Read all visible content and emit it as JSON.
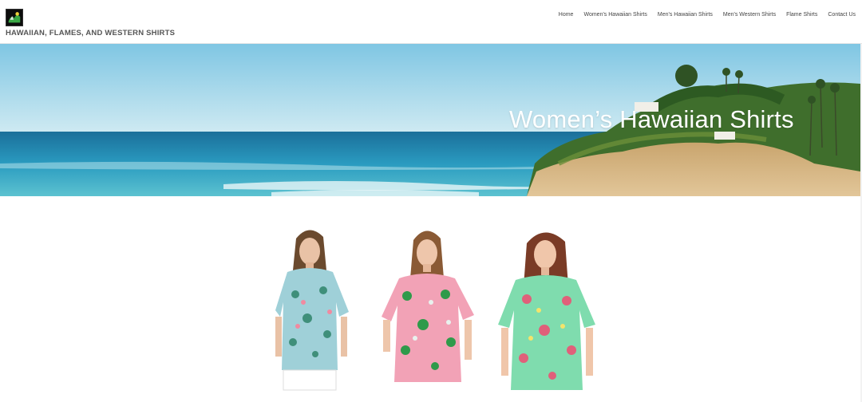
{
  "header": {
    "site_title": "HAWAIIAN, FLAMES, AND WESTERN SHIRTS",
    "logo_icon": "site-logo-icon"
  },
  "nav": {
    "items": [
      {
        "label": "Home"
      },
      {
        "label": "Women's Hawaiian Shirts"
      },
      {
        "label": "Men's Hawaiian Shirts"
      },
      {
        "label": "Men's Western Shirts"
      },
      {
        "label": "Flame Shirts"
      },
      {
        "label": "Contact Us"
      }
    ]
  },
  "hero": {
    "title": "Women’s Hawaiian Shirts"
  },
  "products": [
    {
      "shirt_color": "#9fd0d8",
      "pattern_color": "#3f8f7a"
    },
    {
      "shirt_color": "#f2a2b6",
      "pattern_color": "#2f9a4a"
    },
    {
      "shirt_color": "#7fdcae",
      "pattern_color": "#e0607a"
    }
  ],
  "colors": {
    "sky": "#a8d8ea",
    "ocean": "#1f8fb8",
    "cliff": "#d9b27a"
  }
}
